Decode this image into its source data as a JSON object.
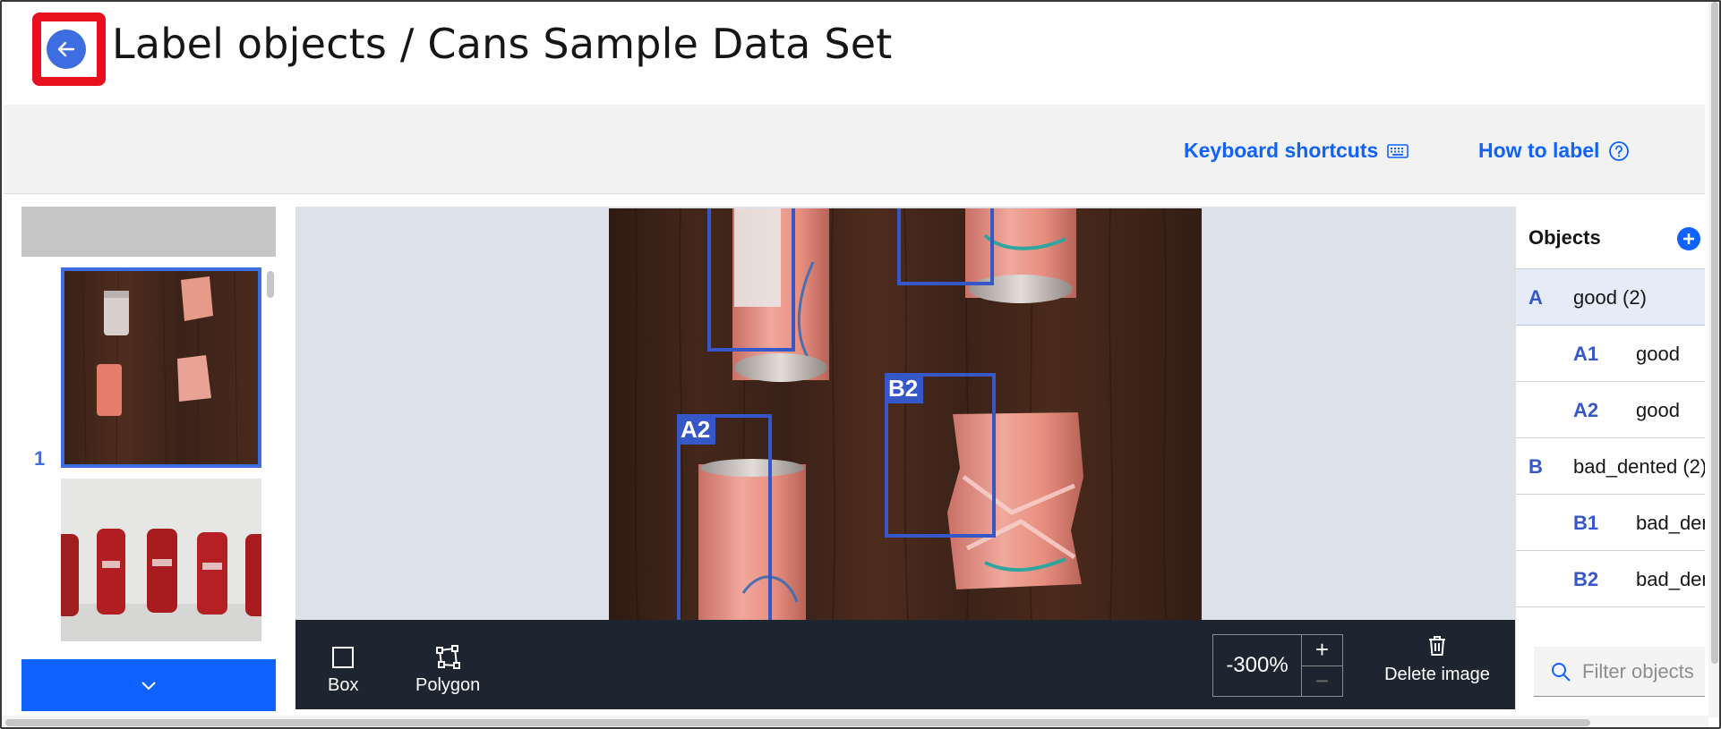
{
  "header": {
    "title": "Label objects / Cans Sample Data Set"
  },
  "toolbar": {
    "keyboard_shortcuts": "Keyboard shortcuts",
    "how_to_label": "How to label"
  },
  "filmstrip": {
    "thumbnails": [
      {
        "number": "1",
        "selected": true,
        "scene": "crushed pink sparkling water cans on wooden table"
      },
      {
        "number": "",
        "selected": false,
        "scene": "red soda cans on white backdrop"
      }
    ]
  },
  "canvas": {
    "boxes": [
      {
        "label": "B2"
      },
      {
        "label": "A2"
      }
    ]
  },
  "bottom_toolbar": {
    "box_label": "Box",
    "polygon_label": "Polygon",
    "zoom_value": "-300%",
    "zoom_in": "+",
    "zoom_out": "−",
    "delete_image_label": "Delete image"
  },
  "objects": {
    "title": "Objects",
    "rows": [
      {
        "id": "A",
        "name": "good (2)",
        "type": "group",
        "selected": true
      },
      {
        "id": "A1",
        "name": "good",
        "type": "child"
      },
      {
        "id": "A2",
        "name": "good",
        "type": "child"
      },
      {
        "id": "B",
        "name": "bad_dented (2)",
        "type": "group"
      },
      {
        "id": "B1",
        "name": "bad_dented",
        "type": "child"
      },
      {
        "id": "B2",
        "name": "bad_dented",
        "type": "child"
      }
    ],
    "filter_placeholder": "Filter objects"
  },
  "colors": {
    "accent_blue": "#0f62fe",
    "box_blue": "#3557c8",
    "highlight_red": "#e8101f",
    "dark_toolbar": "#1c2530"
  }
}
